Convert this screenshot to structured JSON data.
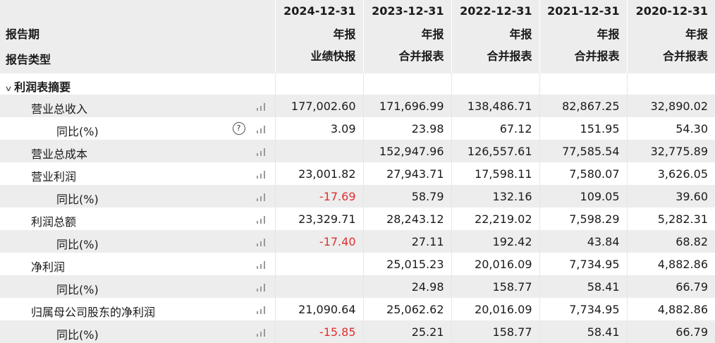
{
  "header": {
    "periods_label": "报告期",
    "types_label": "报告类型",
    "dates": [
      "2024-12-31",
      "2023-12-31",
      "2022-12-31",
      "2021-12-31",
      "2020-12-31"
    ],
    "periods": [
      "年报",
      "年报",
      "年报",
      "年报",
      "年报"
    ],
    "types": [
      "业绩快报",
      "合并报表",
      "合并报表",
      "合并报表",
      "合并报表"
    ]
  },
  "section": {
    "title": "利润表摘要",
    "chevron_icon": "chevron-down-icon"
  },
  "rows": [
    {
      "label": "营业总收入",
      "values": [
        "177,002.60",
        "171,696.99",
        "138,486.71",
        "82,867.25",
        "32,890.02"
      ]
    },
    {
      "label": "同比(%)",
      "values": [
        "3.09",
        "23.98",
        "67.12",
        "151.95",
        "54.30"
      ],
      "help_icon": "?"
    },
    {
      "label": "营业总成本",
      "values": [
        "",
        "152,947.96",
        "126,557.61",
        "77,585.54",
        "32,775.89"
      ]
    },
    {
      "label": "营业利润",
      "values": [
        "23,001.82",
        "27,943.71",
        "17,598.11",
        "7,580.07",
        "3,626.05"
      ]
    },
    {
      "label": "同比(%)",
      "values": [
        "-17.69",
        "58.79",
        "132.16",
        "109.05",
        "39.60"
      ]
    },
    {
      "label": "利润总额",
      "values": [
        "23,329.71",
        "28,243.12",
        "22,219.02",
        "7,598.29",
        "5,282.31"
      ]
    },
    {
      "label": "同比(%)",
      "values": [
        "-17.40",
        "27.11",
        "192.42",
        "43.84",
        "68.82"
      ]
    },
    {
      "label": "净利润",
      "values": [
        "",
        "25,015.23",
        "20,016.09",
        "7,734.95",
        "4,882.86"
      ]
    },
    {
      "label": "同比(%)",
      "values": [
        "",
        "24.98",
        "158.77",
        "58.41",
        "66.79"
      ]
    },
    {
      "label": "归属母公司股东的净利润",
      "values": [
        "21,090.64",
        "25,062.62",
        "20,016.09",
        "7,734.95",
        "4,882.86"
      ]
    },
    {
      "label": "同比(%)",
      "values": [
        "-15.85",
        "25.21",
        "158.77",
        "58.41",
        "66.79"
      ]
    }
  ],
  "colors": {
    "negative": "#e03030",
    "stripe": "#ededed",
    "header_bg": "#ededed"
  }
}
